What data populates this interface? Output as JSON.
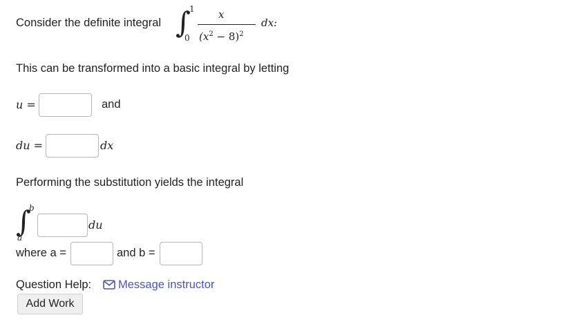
{
  "question": {
    "intro_text": "Consider the definite integral",
    "integral": {
      "upper_limit": "1",
      "lower_limit": "0",
      "numerator": "x",
      "denominator_base": "(x",
      "denominator_exp_inner": "2",
      "denominator_rest": " − 8)",
      "denominator_exp_outer": "2",
      "differential": "dx:"
    },
    "transform_text": "This can be transformed into a basic integral by letting",
    "u_label": "u =",
    "and_text": "and",
    "du_label": "du =",
    "dx_text": "dx",
    "substitution_text": "Performing the substitution yields the integral",
    "second_integral": {
      "upper_limit": "b",
      "lower_limit": "a",
      "differential": "du"
    },
    "where_a_label": "where a =",
    "and_b_label": "and b ="
  },
  "inputs": {
    "u_value": "",
    "du_value": "",
    "integrand_value": "",
    "a_value": "",
    "b_value": ""
  },
  "help": {
    "label": "Question Help:",
    "message_link": "Message instructor",
    "add_work_button": "Add Work"
  },
  "colors": {
    "link": "#4b54b8",
    "text": "#222222",
    "input_border": "#b5b5b5"
  },
  "icons": {
    "message": "envelope-icon"
  }
}
